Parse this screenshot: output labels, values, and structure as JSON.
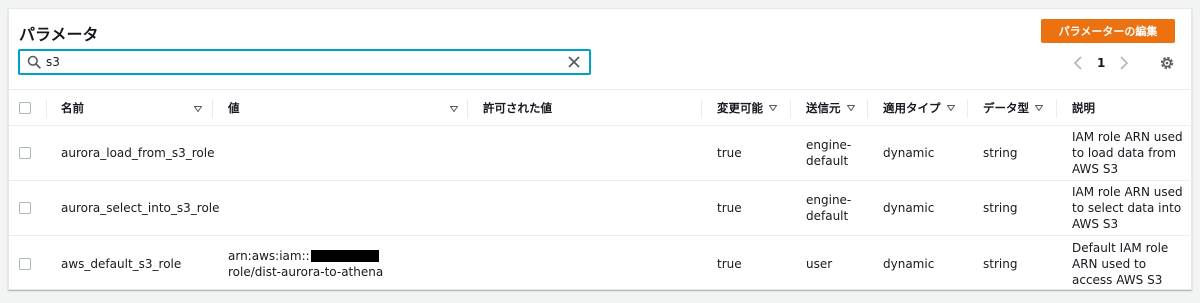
{
  "header": {
    "title": "パラメータ",
    "edit_button": "パラメーターの編集"
  },
  "search": {
    "value": "s3",
    "placeholder": ""
  },
  "pagination": {
    "current_page": "1"
  },
  "icons": {
    "search": "search-icon",
    "clear": "close-icon",
    "prev": "chevron-left-icon",
    "next": "chevron-right-icon",
    "settings": "gear-icon",
    "sort": "caret-down-icon"
  },
  "colors": {
    "accent_orange": "#ec7211",
    "focus_blue": "#00a1c9"
  },
  "table": {
    "columns": [
      "名前",
      "値",
      "許可された値",
      "変更可能",
      "送信元",
      "適用タイプ",
      "データ型",
      "説明"
    ],
    "rows": [
      {
        "name": "aurora_load_from_s3_role",
        "value_prefix": "",
        "value_suffix": "",
        "allowed": "",
        "modifiable": "true",
        "source": "engine-default",
        "apply_type": "dynamic",
        "data_type": "string",
        "description": "IAM role ARN used to load data from AWS S3"
      },
      {
        "name": "aurora_select_into_s3_role",
        "value_prefix": "",
        "value_suffix": "",
        "allowed": "",
        "modifiable": "true",
        "source": "engine-default",
        "apply_type": "dynamic",
        "data_type": "string",
        "description": "IAM role ARN used to select data into AWS S3"
      },
      {
        "name": "aws_default_s3_role",
        "value_prefix": "arn:aws:iam::",
        "value_suffix": "role/dist-aurora-to-athena",
        "allowed": "",
        "modifiable": "true",
        "source": "user",
        "apply_type": "dynamic",
        "data_type": "string",
        "description": "Default IAM role ARN used to access AWS S3"
      }
    ]
  }
}
